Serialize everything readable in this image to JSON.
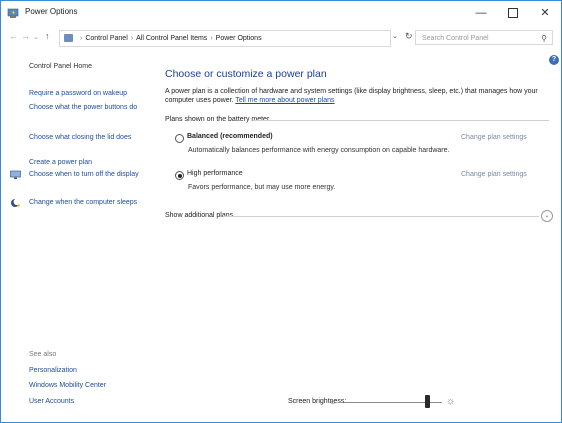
{
  "window": {
    "title": "Power Options",
    "minimize": "—",
    "close": "✕"
  },
  "nav": {
    "back": "←",
    "forward": "→",
    "recent": "⌄",
    "up": "↑",
    "breadcrumb": [
      "Control Panel",
      "All Control Panel Items",
      "Power Options"
    ],
    "dropdown": "⌄",
    "refresh": "↻",
    "search_placeholder": "Search Control Panel"
  },
  "sidebar": {
    "home": "Control Panel Home",
    "links": [
      "Require a password on wakeup",
      "Choose what the power buttons do",
      "Choose what closing the lid does",
      "Create a power plan",
      "Choose when to turn off the display",
      "Change when the computer sleeps"
    ],
    "see_also": "See also",
    "see_also_links": [
      "Personalization",
      "Windows Mobility Center",
      "User Accounts"
    ]
  },
  "main": {
    "help": "?",
    "heading": "Choose or customize a power plan",
    "description": "A power plan is a collection of hardware and system settings (like display brightness, sleep, etc.) that manages how your computer uses power.",
    "description_link": "Tell me more about power plans",
    "plans_header": "Plans shown on the battery meter",
    "plans": [
      {
        "name": "Balanced (recommended)",
        "description": "Automatically balances performance with energy consumption on capable hardware.",
        "change_link": "Change plan settings",
        "selected": false
      },
      {
        "name": "High performance",
        "description": "Favors performance, but may use more energy.",
        "change_link": "Change plan settings",
        "selected": true
      }
    ],
    "additional_plans": "Show additional plans",
    "expand": "⌄"
  },
  "brightness": {
    "label": "Screen brightness:",
    "sun_small": "☼",
    "sun_large": "☼",
    "level": 0.86
  },
  "colors": {
    "accent": "#3a8ad6",
    "heading": "#1d3f91",
    "link": "#1e4c9a"
  }
}
